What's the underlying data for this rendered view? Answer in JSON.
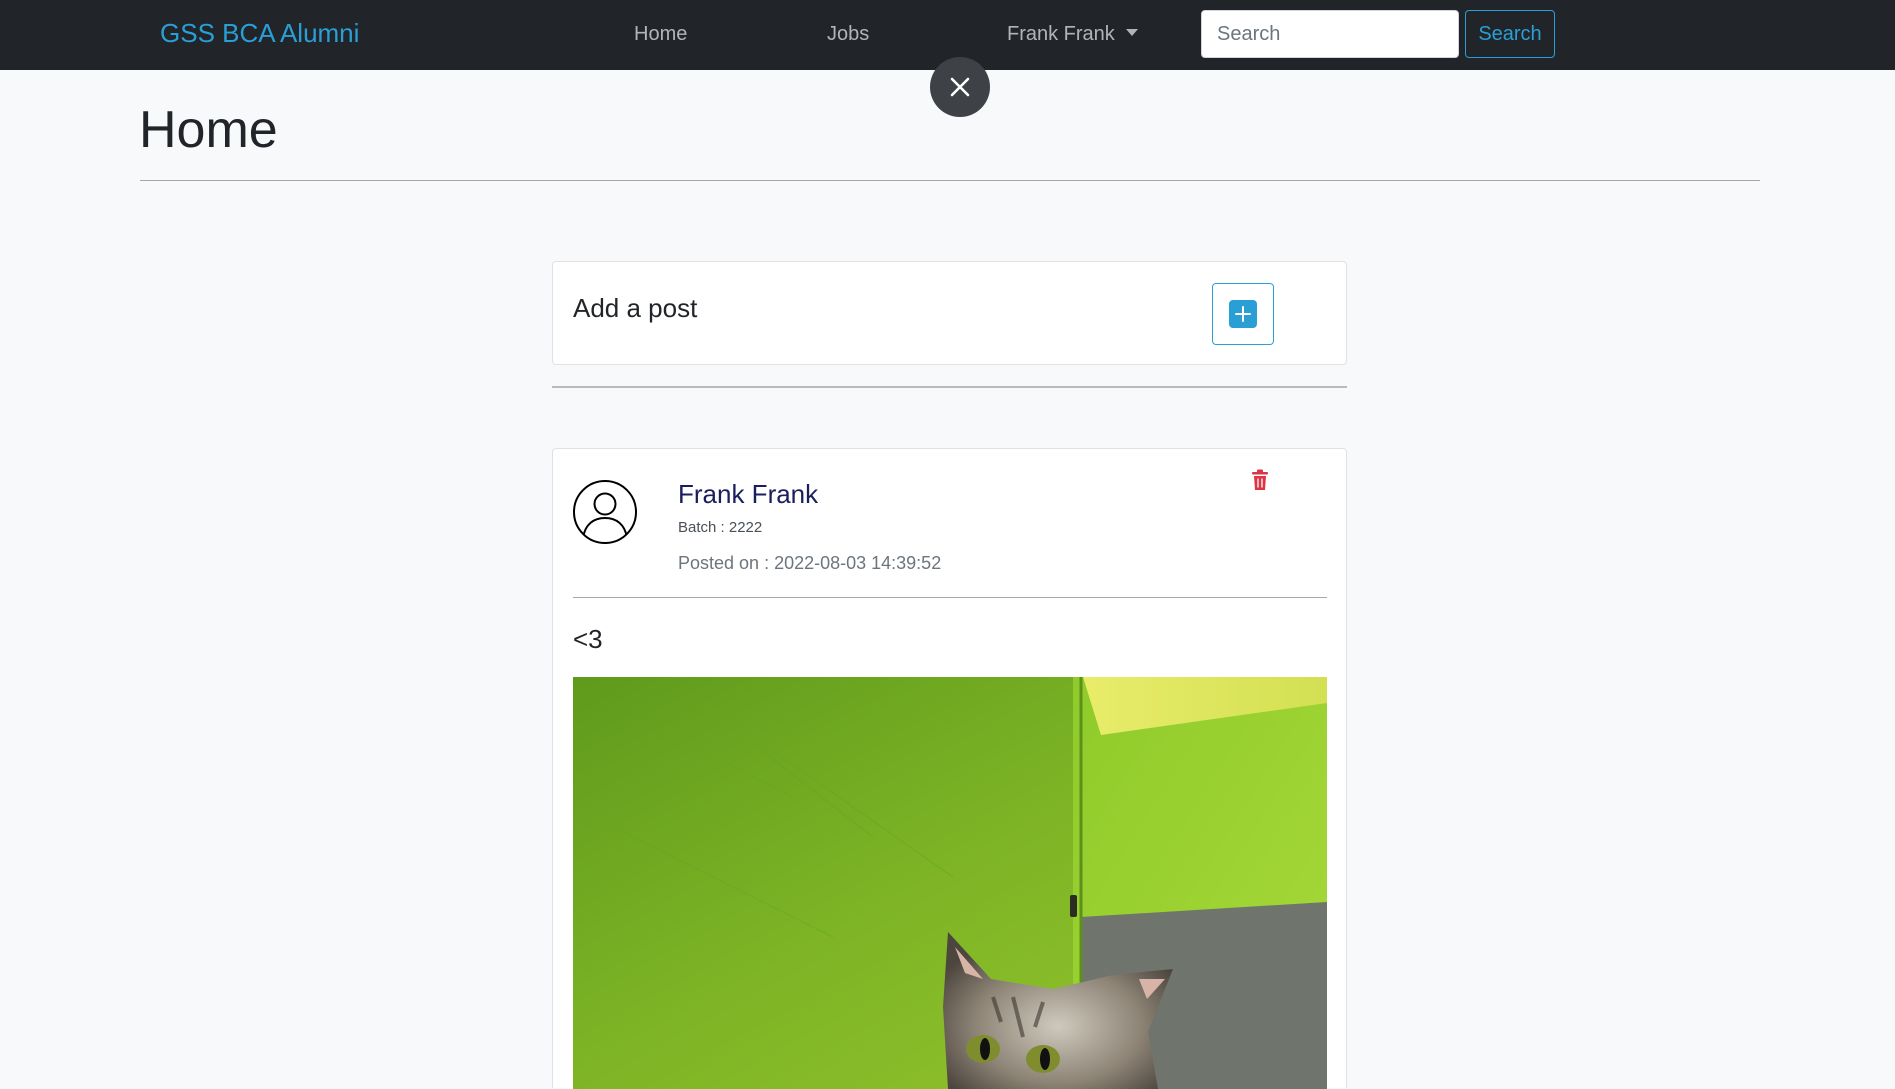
{
  "navbar": {
    "brand": "GSS BCA Alumni",
    "links": {
      "home": "Home",
      "jobs": "Jobs",
      "user": "Frank Frank"
    },
    "search": {
      "placeholder": "Search",
      "button": "Search"
    }
  },
  "page": {
    "title": "Home"
  },
  "add_post": {
    "title": "Add a post"
  },
  "post": {
    "author": "Frank Frank",
    "batch": "Batch : 2222",
    "posted_on": "Posted on : 2022-08-03 14:39:52",
    "text": "<3"
  },
  "colors": {
    "accent": "#2a9fd6",
    "navbar": "#212529",
    "delete": "#dc3545",
    "author": "#1a1e5c"
  },
  "icons": [
    "close-icon",
    "plus-icon",
    "user-avatar-icon",
    "trash-icon",
    "caret-down-icon"
  ]
}
